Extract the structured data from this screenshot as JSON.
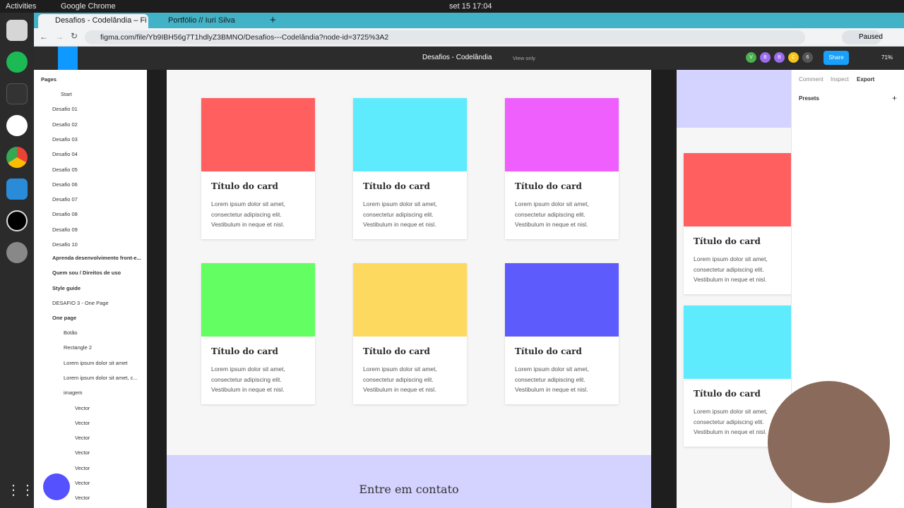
{
  "os": {
    "activities": "Activities",
    "app": "Google Chrome",
    "clock": "set 15  17:04"
  },
  "browser": {
    "tabs": [
      {
        "label": "Desafios - Codelândia – Fi"
      },
      {
        "label": "Portfólio // Iuri Silva"
      }
    ],
    "url": "figma.com/file/Yb9IBH56g7T1hdlyZ3BMNO/Desafios---Codelândia?node-id=3725%3A2",
    "paused_label": "Paused"
  },
  "figma": {
    "file_title": "Desafios - Codelândia",
    "view_only": "View only",
    "share": "Share",
    "zoom": "71%",
    "avatars": [
      "V",
      "B",
      "B",
      "C",
      "6"
    ]
  },
  "layers": {
    "pages_label": "Pages",
    "items": [
      "Start",
      "Desafio 01",
      "Desafio 02",
      "Desafio 03",
      "Desafio 04",
      "Desafio 05",
      "Desafio 06",
      "Desafio 07",
      "Desafio 08",
      "Desafio 09",
      "Desafio 10"
    ],
    "frames": [
      "Aprenda desenvolvimento front-e...",
      "Quem sou / Direitos de uso",
      "Style guide",
      "DESAFIO 3 - One Page",
      "One page"
    ],
    "children": [
      "Botão",
      "Rectangle 2",
      "Lorem ipsum dolor  sit amet",
      "Lorem ipsum dolor sit amet, c...",
      "imagem",
      "Vector",
      "Vector",
      "Vector",
      "Vector",
      "Vector",
      "Vector",
      "Vector"
    ]
  },
  "cards": [
    {
      "title": "Título do card",
      "text": "Lorem ipsum dolor sit amet, consectetur adipiscing elit. Vestibulum in neque et nisl.",
      "color": "#ff5f5f"
    },
    {
      "title": "Título do card",
      "text": "Lorem ipsum dolor sit amet, consectetur adipiscing elit. Vestibulum in neque et nisl.",
      "color": "#5eebfe"
    },
    {
      "title": "Título do card",
      "text": "Lorem ipsum dolor sit amet, consectetur adipiscing elit. Vestibulum in neque et nisl.",
      "color": "#ee5ffe"
    },
    {
      "title": "Título do card",
      "text": "Lorem ipsum dolor sit amet, consectetur adipiscing elit. Vestibulum in neque et nisl.",
      "color": "#62fe62"
    },
    {
      "title": "Título do card",
      "text": "Lorem ipsum dolor sit amet, consectetur adipiscing elit. Vestibulum in neque et nisl.",
      "color": "#fed95f"
    },
    {
      "title": "Título do card",
      "text": "Lorem ipsum dolor sit amet, consectetur adipiscing elit. Vestibulum in neque et nisl.",
      "color": "#5e5bfc"
    }
  ],
  "contact": "Entre em contato",
  "mobile_cards": [
    {
      "title": "Título do card",
      "text": "Lorem ipsum dolor sit amet, consectetur adipiscing elit. Vestibulum in neque et nisl.",
      "color": "#ff5f5f"
    },
    {
      "title": "Título do card",
      "text": "Lorem ipsum dolor sit amet, consectetur adipiscing elit. Vestibulum in neque et nisl.",
      "color": "#5eebfe"
    }
  ],
  "right_panel": {
    "tabs": [
      "Comment",
      "Inspect",
      "Export"
    ],
    "presets": "Presets",
    "add": "+"
  }
}
